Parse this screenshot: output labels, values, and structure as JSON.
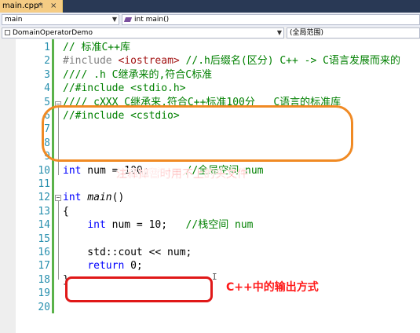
{
  "tab": {
    "title": "main.cpp*",
    "pin": "⊓",
    "close": "×"
  },
  "nav": {
    "file_scope": "main",
    "function": "int main()",
    "project": "DomainOperatorDemo",
    "scope": "(全局范围)"
  },
  "code": [
    {
      "n": "1",
      "text": "// 标准C++库",
      "cls": "cm"
    },
    {
      "n": "2",
      "text": "#include <iostream> //.h后缀名(区分) C++ -> C语言发展而来的",
      "cls": "mix2"
    },
    {
      "n": "3",
      "text": "//// .h C继承来的,符合C标准",
      "cls": "cm"
    },
    {
      "n": "4",
      "text": "//#include <stdio.h>",
      "cls": "cm"
    },
    {
      "n": "5",
      "text": "//// cXXX C继承来,符合C++标准100分   C语言的标准库",
      "cls": "cm"
    },
    {
      "n": "6",
      "text": "//#include <cstdio>",
      "cls": "cm"
    },
    {
      "n": "7",
      "text": "",
      "cls": ""
    },
    {
      "n": "8",
      "text": "",
      "cls": ""
    },
    {
      "n": "9",
      "text": "",
      "cls": ""
    },
    {
      "n": "10",
      "text": "int num = 100;      //全局空间 num",
      "cls": "mix10"
    },
    {
      "n": "11",
      "text": "",
      "cls": ""
    },
    {
      "n": "12",
      "text": "int main()",
      "cls": "mix12"
    },
    {
      "n": "13",
      "text": "{",
      "cls": ""
    },
    {
      "n": "14",
      "text": "    int num = 10;   //栈空间 num",
      "cls": "mix14"
    },
    {
      "n": "15",
      "text": "",
      "cls": ""
    },
    {
      "n": "16",
      "text": "    std::cout << num;",
      "cls": ""
    },
    {
      "n": "17",
      "text": "    return 0;",
      "cls": "mix17"
    },
    {
      "n": "18",
      "text": "}",
      "cls": ""
    },
    {
      "n": "19",
      "text": "",
      "cls": ""
    },
    {
      "n": "20",
      "text": "",
      "cls": ""
    }
  ],
  "annotations": {
    "orange_label": "注释掉暂时用不上的头文件",
    "red_label": "C++中的输出方式"
  },
  "colors": {
    "accent_orange": "#f08a24",
    "accent_red": "#e01818",
    "keyword": "#0000ff",
    "comment": "#008000"
  }
}
